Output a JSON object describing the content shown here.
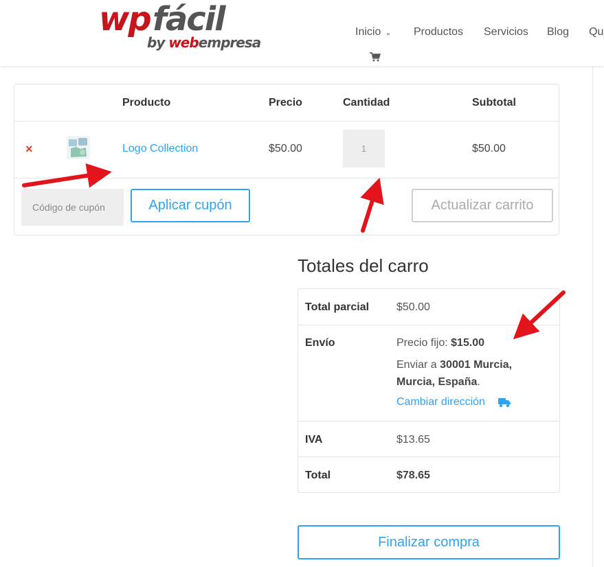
{
  "brand": {
    "logo_wp": "wp",
    "logo_facil": "fácil",
    "logo_by": "by ",
    "logo_web": "web",
    "logo_empresa": "empresa",
    "accent_red": "#c4161c",
    "link_blue": "#2ea3f2"
  },
  "nav": {
    "items": [
      {
        "label": "Inicio",
        "has_dropdown": true
      },
      {
        "label": "Productos"
      },
      {
        "label": "Servicios"
      },
      {
        "label": "Blog"
      },
      {
        "label": "Qu"
      }
    ],
    "cart_icon": "shopping-cart-icon"
  },
  "cart": {
    "headers": {
      "product": "Producto",
      "price": "Precio",
      "quantity": "Cantidad",
      "subtotal": "Subtotal"
    },
    "rows": [
      {
        "remove_symbol": "×",
        "product_name": "Logo Collection",
        "price": "$50.00",
        "quantity": "1",
        "subtotal": "$50.00"
      }
    ],
    "coupon_placeholder": "Código de cupón",
    "apply_coupon_label": "Aplicar cupón",
    "update_cart_label": "Actualizar carrito"
  },
  "totals": {
    "title": "Totales del carro",
    "subtotal_label": "Total parcial",
    "subtotal_value": "$50.00",
    "shipping_label": "Envío",
    "shipping_method": "Precio fijo: ",
    "shipping_cost": "$15.00",
    "ship_to_prefix": "Enviar a ",
    "ship_to_address_line1": "30001 Murcia,",
    "ship_to_address_line2": "Murcia, España",
    "ship_to_suffix": ".",
    "change_address_label": "Cambiar dirección",
    "tax_label": "IVA",
    "tax_value": "$13.65",
    "total_label": "Total",
    "total_value": "$78.65"
  },
  "checkout_label": "Finalizar compra"
}
